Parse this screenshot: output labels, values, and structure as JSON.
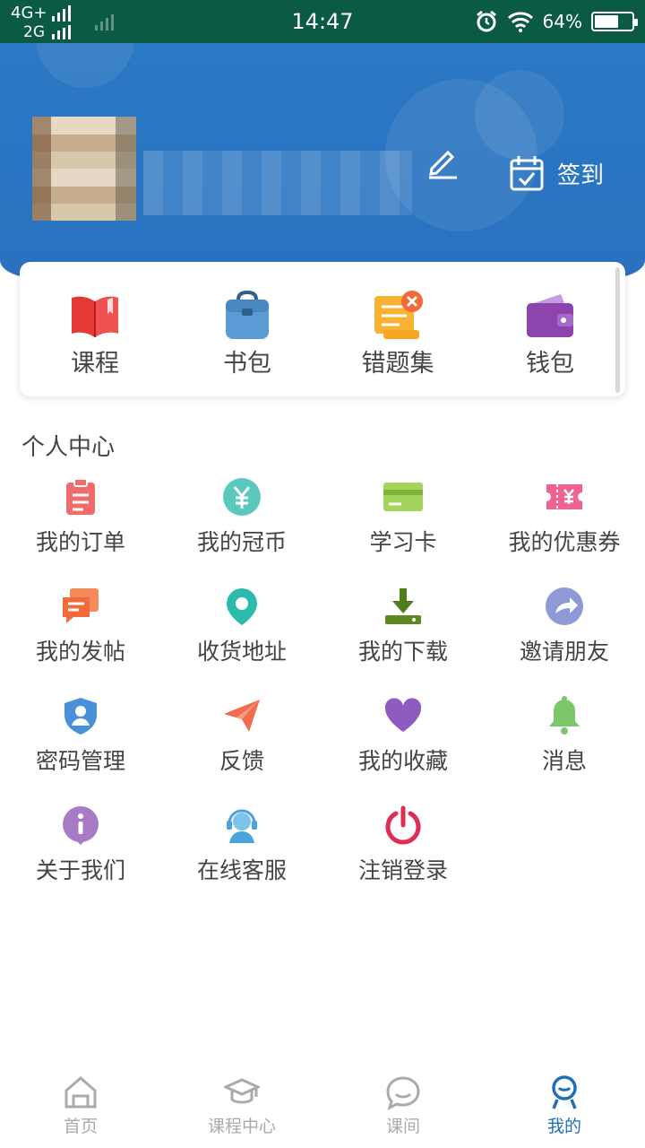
{
  "status_bar": {
    "network_primary": "4G+",
    "network_secondary": "2G",
    "time": "14:47",
    "battery": "64%",
    "battery_level": 0.64,
    "icons": [
      "signal-icon",
      "alarm-icon",
      "wifi-icon",
      "battery-icon"
    ]
  },
  "header": {
    "signin_label": "签到",
    "edit_icon": "pencil-icon",
    "signin_icon": "calendar-check-icon",
    "bg_color": "#2b78c4"
  },
  "quick_actions": [
    {
      "label": "课程",
      "icon": "book-icon"
    },
    {
      "label": "书包",
      "icon": "schoolbag-icon"
    },
    {
      "label": "错题集",
      "icon": "error-notes-icon"
    },
    {
      "label": "钱包",
      "icon": "wallet-icon"
    }
  ],
  "personal_center": {
    "title": "个人中心",
    "items": [
      {
        "label": "我的订单",
        "icon": "order-icon",
        "color": "#f26b6b"
      },
      {
        "label": "我的冠币",
        "icon": "coin-icon",
        "color": "#5bc8c0"
      },
      {
        "label": "学习卡",
        "icon": "card-icon",
        "color": "#a4d45c"
      },
      {
        "label": "我的优惠券",
        "icon": "coupon-icon",
        "color": "#f06292"
      },
      {
        "label": "我的发帖",
        "icon": "post-icon",
        "color": "#f26a3a"
      },
      {
        "label": "收货地址",
        "icon": "location-icon",
        "color": "#2bbbad"
      },
      {
        "label": "我的下载",
        "icon": "download-icon",
        "color": "#5a8a20"
      },
      {
        "label": "邀请朋友",
        "icon": "share-icon",
        "color": "#8e99d6"
      },
      {
        "label": "密码管理",
        "icon": "shield-user-icon",
        "color": "#4a90d9"
      },
      {
        "label": "反馈",
        "icon": "paper-plane-icon",
        "color": "#f26b4f"
      },
      {
        "label": "我的收藏",
        "icon": "heart-icon",
        "color": "#8e5bbf"
      },
      {
        "label": "消息",
        "icon": "bell-icon",
        "color": "#7dc76b"
      },
      {
        "label": "关于我们",
        "icon": "info-icon",
        "color": "#a87bc7"
      },
      {
        "label": "在线客服",
        "icon": "headset-icon",
        "color": "#4aa3d9"
      },
      {
        "label": "注销登录",
        "icon": "power-icon",
        "color": "#e02d55"
      }
    ]
  },
  "bottom_nav": {
    "active_index": 3,
    "items": [
      {
        "label": "首页",
        "icon": "home-icon"
      },
      {
        "label": "课程中心",
        "icon": "graduation-cap-icon"
      },
      {
        "label": "课间",
        "icon": "chat-bubble-icon"
      },
      {
        "label": "我的",
        "icon": "user-icon"
      }
    ]
  }
}
